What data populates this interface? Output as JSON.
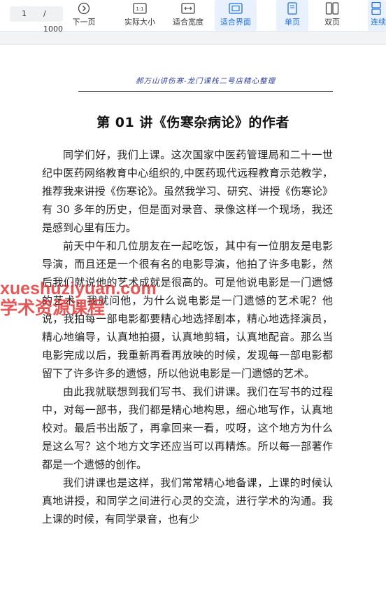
{
  "toolbar": {
    "page_current": "1",
    "page_total": "/ 1000",
    "buttons": [
      {
        "id": "next",
        "label": "下一页",
        "icon": "chevron-right-circle-icon"
      },
      {
        "id": "actual",
        "label": "实际大小",
        "icon": "actual-size-icon",
        "icon_text": "1:1"
      },
      {
        "id": "fitwidth",
        "label": "适合宽度",
        "icon": "fit-width-icon"
      },
      {
        "id": "fitpage",
        "label": "适合界面",
        "icon": "fit-page-icon"
      },
      {
        "id": "single",
        "label": "单页",
        "icon": "single-page-icon"
      },
      {
        "id": "double",
        "label": "双页",
        "icon": "double-page-icon"
      },
      {
        "id": "continuous",
        "label": "连续",
        "icon": "continuous-page-icon"
      }
    ],
    "active_color": "#1e6fdc"
  },
  "document": {
    "running_header": "郝万山讲伤寒-龙门课栈二号店精心整理",
    "chapter_title": "第 01 讲《伤寒杂病论》的作者",
    "paragraphs": [
      "同学们好，我们上课。这次国家中医药管理局和二十一世纪中医药网络教育中心组织的,中医药现代远程教育示范教学，推荐我来讲授《伤寒论》。虽然我学习、研究、讲授《伤寒论》有 30 多年的历史，但是面对录音、录像这样一个现场，我还是感到心里有压力。",
      "前天中午和几位朋友在一起吃饭，其中有一位朋友是电影导演，而且还是一个很有名的电影导演，他拍了许多电影，然后我们就说他的艺术成就是很高的。可是他说电影是一门遗憾的艺术，我就问他，为什么说电影是一门遗憾的艺术呢？他说，我拍每一部电影都要精心地选择剧本，精心地选择演员，精心地编导，认真地拍摄，认真地剪辑，认真地配音。那么当电影完成以后，我重新再看再放映的时候，发现每一部电影都留下了许多许多的遗憾，所以他说电影是一门遗憾的艺术。",
      "由此我就联想到我们写书、我们讲课。我们在写书的过程中，对每一部书，我们都是精心地构思，细心地写作，认真地校对。最后书出版了，再拿回来一看，哎呀，这个地方为什么是这么写？这个地方文字还应当可以再精炼。所以每一部著作都是一个遗憾的创作。",
      "我们讲课也是这样，我们常常精心地备课，上课的时候认真地讲授，和同学之间进行心灵的交流，进行学术的沟通。我上课的时候，有同学录音，也有少"
    ]
  },
  "watermark": {
    "line1": "xueshuziyuan.com",
    "line2": "学术资源课程",
    "color": "#e02828"
  }
}
